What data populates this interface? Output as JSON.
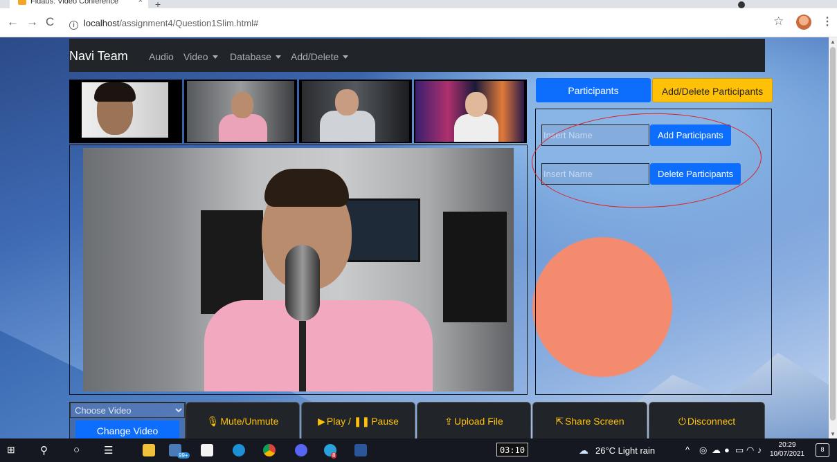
{
  "browser": {
    "tab_title": "Fidaus: Video Conference",
    "tab_close": "×",
    "new_tab": "+",
    "back": "←",
    "forward": "→",
    "reload": "C",
    "info": "i",
    "url_host": "localhost",
    "url_path": "/assignment4/Question1Slim.html#",
    "star": "☆",
    "menu": "⋮"
  },
  "navbar": {
    "brand": "Navi Team",
    "items": [
      "Audio",
      "Video",
      "Database",
      "Add/Delete"
    ]
  },
  "side": {
    "tab_participants": "Participants",
    "tab_add_delete": "Add/Delete Participants",
    "add_placeholder": "Insert Name",
    "add_button": "Add Participants",
    "delete_placeholder": "Insert Name",
    "delete_button": "Delete Participants"
  },
  "controls": {
    "choose_video": "Choose Video",
    "change_video": "Change Video",
    "mute": "Mute/Unmute",
    "play": "Play / ",
    "pause": "Pause",
    "upload": "Upload File",
    "share": "Share Screen",
    "disconnect": "Disconnect",
    "icon_mic": "🎙",
    "icon_play": "▶",
    "icon_pause": "❚❚",
    "icon_upload": "⇪",
    "icon_share": "⇱",
    "icon_power": "⏻"
  },
  "taskbar": {
    "timer": "03:10",
    "badge_files": "99+",
    "badge_chrome": "8",
    "weather": "26°C  Light rain",
    "time": "20:29",
    "date": "10/07/2021",
    "notifications": "8"
  },
  "colors": {
    "primary": "#0d6efd",
    "warning": "#ffc107",
    "dark": "#212529",
    "annotation": "#e02020"
  }
}
